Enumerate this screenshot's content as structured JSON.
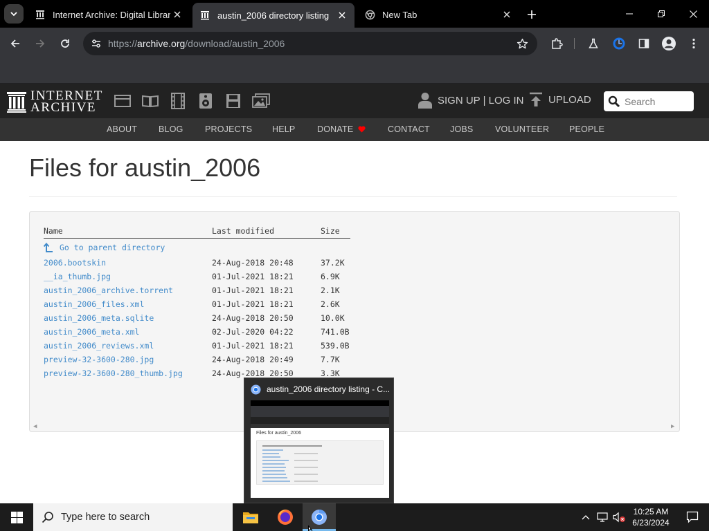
{
  "browser": {
    "tabs": [
      {
        "title": "Internet Archive: Digital Librar",
        "active": false
      },
      {
        "title": "austin_2006 directory listing",
        "active": true
      },
      {
        "title": "New Tab",
        "active": false
      }
    ],
    "url_prefix": "https://",
    "url_host": "archive.org",
    "url_path": "/download/austin_2006"
  },
  "ia_header": {
    "logo_line1": "INTERNET",
    "logo_line2": "ARCHIVE",
    "media_icons": [
      "web-icon",
      "texts-icon",
      "video-icon",
      "audio-icon",
      "software-icon",
      "images-icon"
    ],
    "signup_label": "SIGN UP | LOG IN",
    "upload_label": "UPLOAD",
    "search_placeholder": "Search",
    "nav": [
      "ABOUT",
      "BLOG",
      "PROJECTS",
      "HELP",
      "DONATE",
      "CONTACT",
      "JOBS",
      "VOLUNTEER",
      "PEOPLE"
    ]
  },
  "listing": {
    "title": "Files for austin_2006",
    "headers": {
      "name": "Name",
      "modified": "Last modified",
      "size": "Size"
    },
    "parent_label": "Go to parent directory",
    "files": [
      {
        "name": "2006.bootskin",
        "modified": "24-Aug-2018 20:48",
        "size": "37.2K"
      },
      {
        "name": "__ia_thumb.jpg",
        "modified": "01-Jul-2021 18:21",
        "size": "6.9K"
      },
      {
        "name": "austin_2006_archive.torrent",
        "modified": "01-Jul-2021 18:21",
        "size": "2.1K"
      },
      {
        "name": "austin_2006_files.xml",
        "modified": "01-Jul-2021 18:21",
        "size": "2.6K"
      },
      {
        "name": "austin_2006_meta.sqlite",
        "modified": "24-Aug-2018 20:50",
        "size": "10.0K"
      },
      {
        "name": "austin_2006_meta.xml",
        "modified": "02-Jul-2020 04:22",
        "size": "741.0B"
      },
      {
        "name": "austin_2006_reviews.xml",
        "modified": "01-Jul-2021 18:21",
        "size": "539.0B"
      },
      {
        "name": "preview-32-3600-280.jpg",
        "modified": "24-Aug-2018 20:49",
        "size": "7.7K"
      },
      {
        "name": "preview-32-3600-280_thumb.jpg",
        "modified": "24-Aug-2018 20:50",
        "size": "3.3K"
      }
    ]
  },
  "thumbnail_popup": {
    "title": "austin_2006 directory listing - C...",
    "mini_title": "Files for austin_2006"
  },
  "taskbar": {
    "search_placeholder": "Type here to search",
    "apps": [
      "file-explorer-icon",
      "firefox-icon",
      "chrome-icon"
    ],
    "active_app": "chrome-icon",
    "time": "10:25 AM",
    "date": "6/23/2024"
  },
  "colors": {
    "link": "#428bca",
    "ia_header_bg": "#222222",
    "ia_nav_bg": "#333333",
    "browser_tab_bg": "#000000",
    "browser_toolbar_bg": "#35363a",
    "donate_heart": "#ff0000"
  }
}
